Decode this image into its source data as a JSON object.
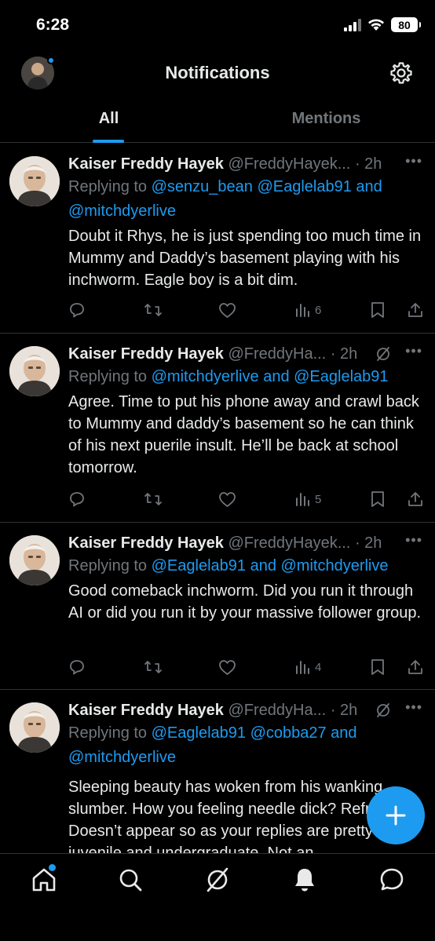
{
  "status": {
    "time": "6:28",
    "battery": "80"
  },
  "header": {
    "title": "Notifications"
  },
  "tabs": [
    {
      "label": "All"
    },
    {
      "label": "Mentions"
    }
  ],
  "tweets": [
    {
      "name": "Kaiser Freddy Hayek",
      "handle": "@FreddyHayek...",
      "time": "· 2h",
      "replying_prefix": "Replying to ",
      "mention_line1": "@senzu_bean @Eaglelab91",
      "and1": " and",
      "mention_line2": "@mitchdyerlive",
      "text": "Doubt it Rhys, he is just spending too much time in Mummy and Daddy’s basement playing with his inchworm.  Eagle boy is a bit dim.",
      "views": "6"
    },
    {
      "name": "Kaiser Freddy Hayek",
      "handle": "@FreddyHa...",
      "time": "· 2h",
      "replying_prefix": "Replying to ",
      "mention_a": "@mitchdyerlive",
      "and": " and ",
      "mention_b": "@Eaglelab91",
      "text": "Agree. Time to put his phone away and crawl back to Mummy and daddy’s basement so he can think of his next puerile insult. He’ll be back at school tomorrow.",
      "views": "5"
    },
    {
      "name": "Kaiser Freddy Hayek",
      "handle": "@FreddyHayek...",
      "time": "· 2h",
      "replying_prefix": "Replying to ",
      "mention_a": "@Eaglelab91",
      "and": " and ",
      "mention_b": "@mitchdyerlive",
      "text": "Good comeback inchworm.  Did you run it through AI or did you run it by your massive follower group.",
      "views": "4"
    },
    {
      "name": "Kaiser Freddy Hayek",
      "handle": "@FreddyHa...",
      "time": "· 2h",
      "replying_prefix": "Replying to ",
      "mention_line1": "@Eaglelab91 @cobba27",
      "and1": " and",
      "mention_line2": "@mitchdyerlive",
      "text": "Sleeping beauty has woken from his wanking slumber.  How you feeling needle dick? Refreshed? Doesn’t appear so as your replies are pretty juvenile and undergraduate.  Not an"
    }
  ],
  "icons": {
    "reply": "reply-icon",
    "retweet": "retweet-icon",
    "like": "like-icon",
    "views": "views-icon",
    "bookmark": "bookmark-icon",
    "share": "share-icon",
    "more": "more-icon",
    "grok": "grok-icon"
  },
  "colors": {
    "accent": "#1d9bf0",
    "text": "#e7e9ea",
    "muted": "#71767b",
    "divider": "#2f3336"
  }
}
